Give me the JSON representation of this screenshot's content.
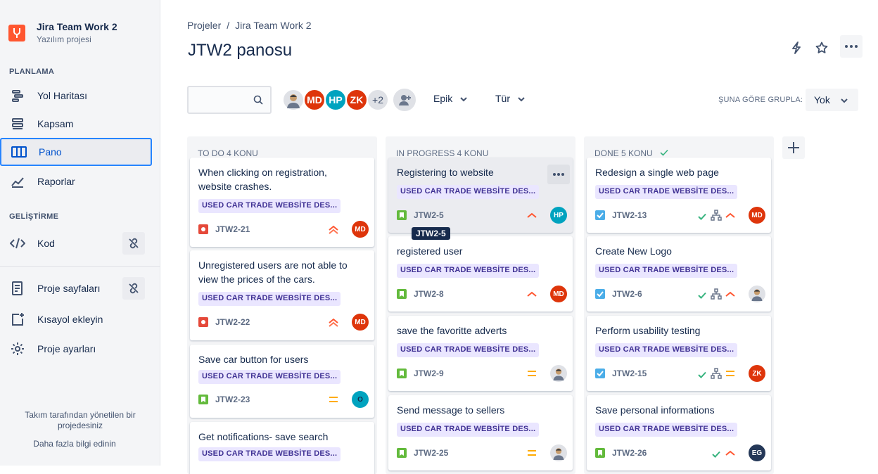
{
  "sidebar": {
    "project_name": "Jira Team Work 2",
    "project_type": "Yazılım projesi",
    "planning_label": "PLANLAMA",
    "items": [
      {
        "label": "Yol Haritası"
      },
      {
        "label": "Kapsam"
      },
      {
        "label": "Pano"
      },
      {
        "label": "Raporlar"
      }
    ],
    "dev_label": "GELİŞTİRME",
    "dev_items": [
      {
        "label": "Kod"
      }
    ],
    "bottom_items": [
      {
        "label": "Proje sayfaları"
      },
      {
        "label": "Kısayol ekleyin"
      },
      {
        "label": "Proje ayarları"
      }
    ],
    "footer_text": "Takım tarafından yönetilen bir projedesiniz",
    "footer_link": "Daha fazla bilgi edinin"
  },
  "header": {
    "breadcrumb": [
      "Projeler",
      "Jira Team Work 2"
    ],
    "title": "JTW2 panosu"
  },
  "toolbar": {
    "avatars": [
      {
        "initials": "",
        "color": "#ffffff"
      },
      {
        "initials": "MD",
        "color": "#de350b"
      },
      {
        "initials": "HP",
        "color": "#00a3bf"
      },
      {
        "initials": "ZK",
        "color": "#de350b"
      },
      {
        "initials": "+2",
        "color": "#dfe1e6"
      }
    ],
    "epic_label": "Epik",
    "type_label": "Tür",
    "group_label": "ŞUNA GÖRE GRUPLA:",
    "group_value": "Yok"
  },
  "columns": [
    {
      "title": "TO DO 4 KONU",
      "cards": [
        {
          "title": "When clicking on registration, website crashes.",
          "epic": "USED CAR TRADE WEBSİTE DES...",
          "key": "JTW2-21",
          "type": "bug",
          "priority": "highest",
          "assignee": "MD"
        },
        {
          "title": "Unregistered users are not able to view the prices of the cars.",
          "epic": "USED CAR TRADE WEBSİTE DES...",
          "key": "JTW2-22",
          "type": "bug",
          "priority": "highest",
          "assignee": "MD"
        },
        {
          "title": "Save car button for users",
          "epic": "USED CAR TRADE WEBSİTE DES...",
          "key": "JTW2-23",
          "type": "story",
          "priority": "medium",
          "assignee": "O"
        },
        {
          "title": "Get notifications- save search",
          "epic": "USED CAR TRADE WEBSİTE DES...",
          "key": "",
          "type": "story",
          "priority": "",
          "assignee": ""
        }
      ]
    },
    {
      "title": "IN PROGRESS 4 KONU",
      "cards": [
        {
          "title": "Registering to website",
          "epic": "USED CAR TRADE WEBSİTE DES...",
          "key": "JTW2-5",
          "type": "story",
          "priority": "high",
          "assignee": "HP"
        },
        {
          "title": "registered user",
          "epic": "USED CAR TRADE WEBSİTE DES...",
          "key": "JTW2-8",
          "type": "story",
          "priority": "high",
          "assignee": "MD"
        },
        {
          "title": "save the favoritte adverts",
          "epic": "USED CAR TRADE WEBSİTE DES...",
          "key": "JTW2-9",
          "type": "story",
          "priority": "medium",
          "assignee": "photo"
        },
        {
          "title": "Send message to sellers",
          "epic": "USED CAR TRADE WEBSİTE DES...",
          "key": "JTW2-25",
          "type": "story",
          "priority": "medium",
          "assignee": "photo"
        }
      ]
    },
    {
      "title": "DONE 5 KONU",
      "cards": [
        {
          "title": "Redesign a single web page",
          "epic": "USED CAR TRADE WEBSİTE DES...",
          "key": "JTW2-13",
          "type": "task",
          "priority": "high",
          "assignee": "MD"
        },
        {
          "title": "Create New Logo",
          "epic": "USED CAR TRADE WEBSİTE DES...",
          "key": "JTW2-6",
          "type": "task",
          "priority": "high",
          "assignee": "photo"
        },
        {
          "title": "Perform usability testing",
          "epic": "USED CAR TRADE WEBSİTE DES...",
          "key": "JTW2-15",
          "type": "task",
          "priority": "medium",
          "assignee": "ZK"
        },
        {
          "title": "Save personal informations",
          "epic": "USED CAR TRADE WEBSİTE DES...",
          "key": "JTW2-26",
          "type": "story",
          "priority": "high",
          "assignee": "EG"
        }
      ]
    }
  ],
  "tooltip": "JTW2-5",
  "colors": {
    "primary": "#0052cc",
    "bug": "#e5493a",
    "story": "#63ba3c",
    "task": "#4bade8",
    "epic_bg": "#eae6ff",
    "epic_text": "#403294"
  }
}
